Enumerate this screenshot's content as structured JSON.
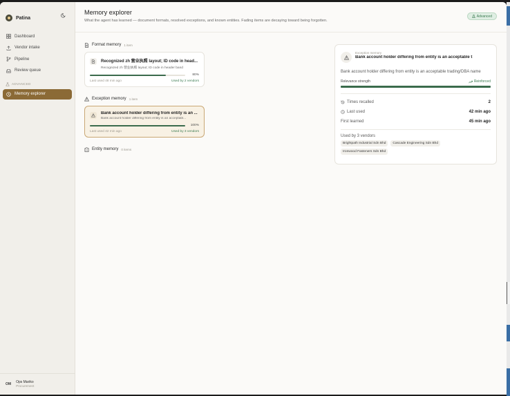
{
  "app": {
    "name": "Patina"
  },
  "sidebar": {
    "items": [
      {
        "label": "Dashboard",
        "icon": "grid-icon"
      },
      {
        "label": "Vendor intake",
        "icon": "upload-icon"
      },
      {
        "label": "Pipeline",
        "icon": "branch-icon"
      },
      {
        "label": "Review queue",
        "icon": "inbox-icon"
      }
    ],
    "section_label": "ADVANCED",
    "advanced_items": [
      {
        "label": "Memory explorer",
        "icon": "memory-icon",
        "active": true
      }
    ],
    "user": {
      "initials": "OM",
      "name": "Ops Mariko",
      "role": "Procurement"
    }
  },
  "header": {
    "title": "Memory explorer",
    "subtitle": "What the agent has learned — document formats, resolved exceptions, and known entities. Fading items are decaying toward being forgotten.",
    "badge": "Advanced"
  },
  "sections": {
    "format": {
      "title": "Format memory",
      "count": "1 item",
      "card": {
        "title": "Recognized zh 营业执照 layout; ID code in head...",
        "desc": "Recognized zh 营业执照 layout; ID code in header band",
        "strength": 0.8,
        "pct": "80%",
        "last": "Last used 48 min ago",
        "used_by": "Used by 2 vendors"
      }
    },
    "exception": {
      "title": "Exception memory",
      "count": "1 item",
      "card": {
        "title": "Bank account holder differing from entity is an ...",
        "desc": "Bank account holder differing from entity is an acceptabl...",
        "strength": 1.0,
        "pct": "100%",
        "last": "Last used 42 min ago",
        "used_by": "Used by 3 vendors"
      }
    },
    "entity": {
      "title": "Entity memory",
      "count": "0 items"
    }
  },
  "detail": {
    "kind": "Exception memory",
    "title": "Bank account holder differing from entity is an acceptable t",
    "description": "Bank account holder differing from entity is an acceptable trading/DBA name",
    "relevance_label": "Relevance strength",
    "relevance_status": "Reinforced",
    "relevance": 1.0,
    "stats": [
      {
        "label": "Times recalled",
        "value": "2",
        "icon": "history-icon"
      },
      {
        "label": "Last used",
        "value": "42 min ago",
        "icon": "clock-icon"
      },
      {
        "label": "First learned",
        "value": "45 min ago",
        "icon": ""
      }
    ],
    "vendors_label": "Used by 3 vendors",
    "vendors": [
      "Brightpath Industrial Sdn Bhd",
      "Cascade Engineering Sdn Bhd",
      "Ironwood Fasteners Sdn Bhd"
    ]
  },
  "colors": {
    "accent": "#8b6a36",
    "success": "#3a6b4c",
    "badge_bg": "#dfeee3"
  }
}
